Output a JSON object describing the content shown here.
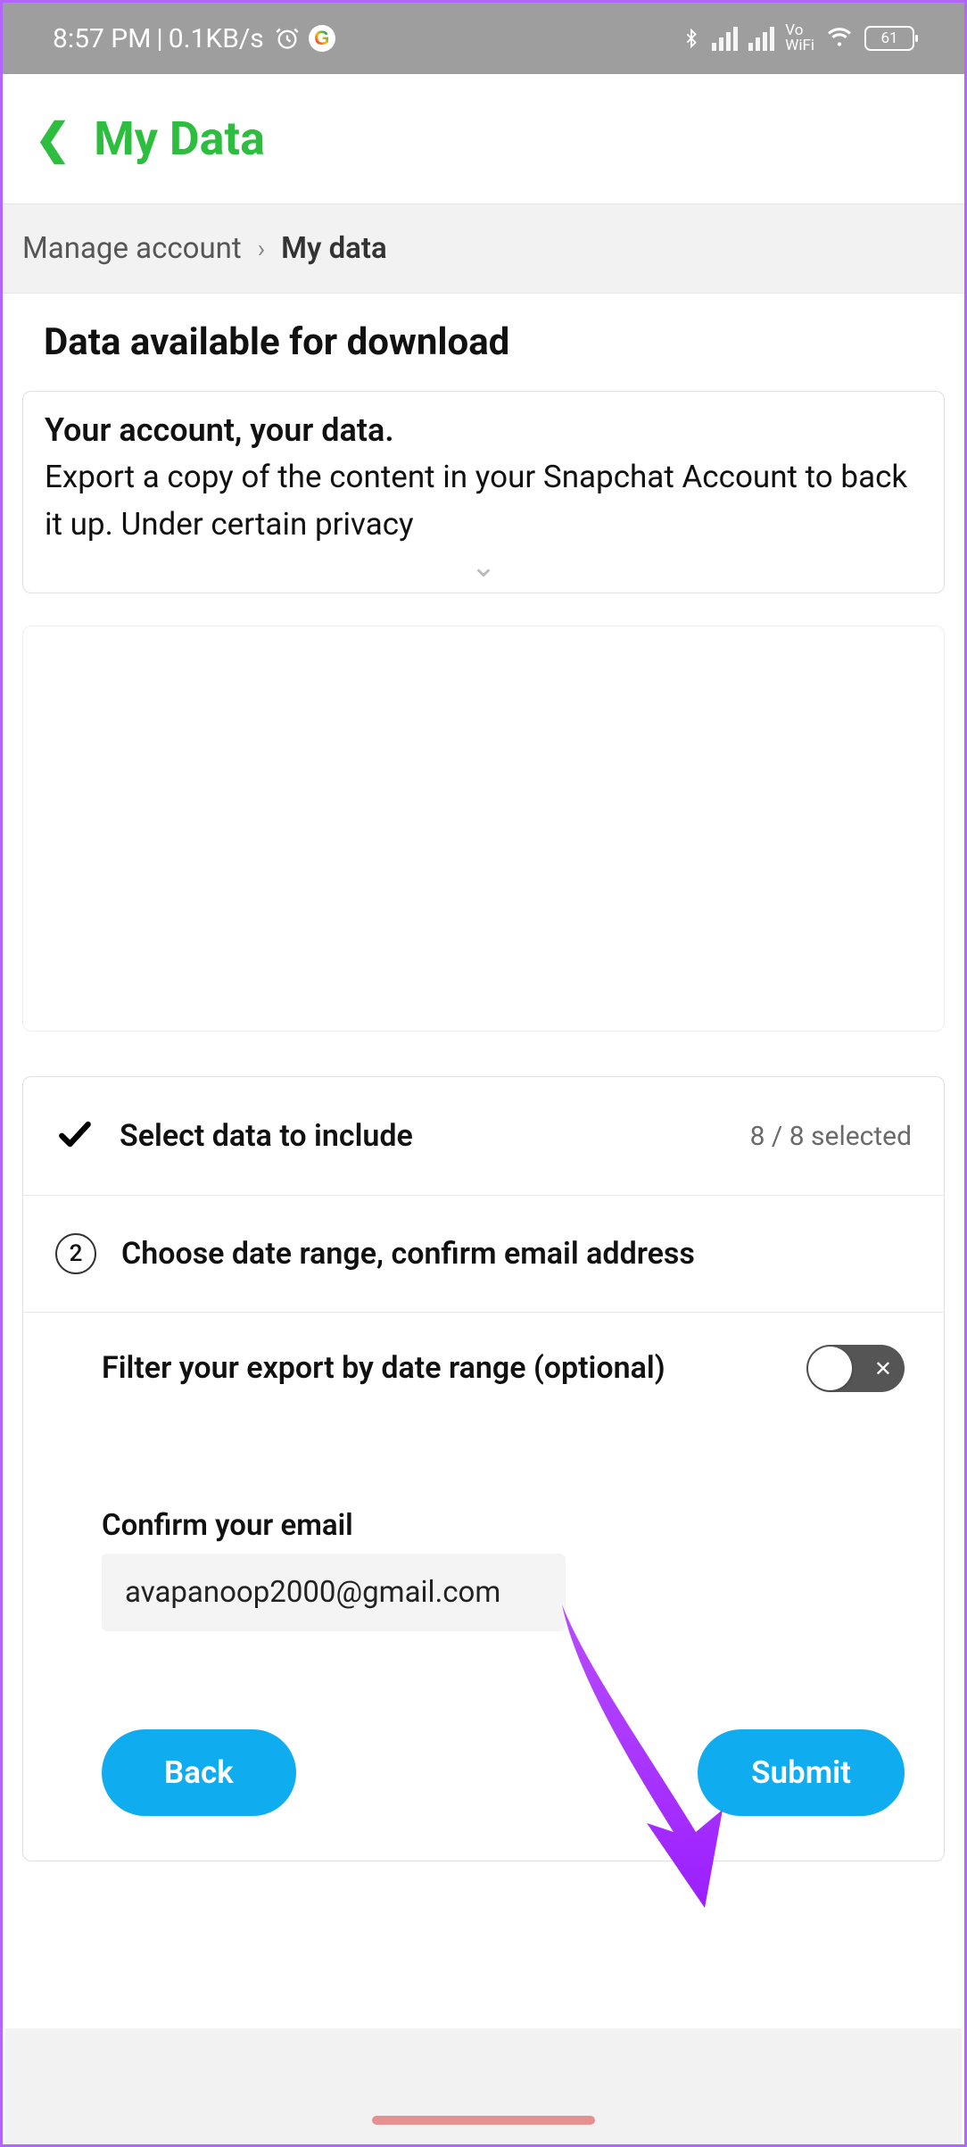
{
  "status": {
    "time": "8:57 PM",
    "net_speed": "0.1KB/s",
    "vowifi_top": "Vo",
    "vowifi_bottom": "WiFi",
    "battery": "61"
  },
  "nav": {
    "title": "My Data"
  },
  "breadcrumb": {
    "parent": "Manage account",
    "current": "My data"
  },
  "page": {
    "heading": "Data available for download"
  },
  "info": {
    "title": "Your account, your data.",
    "body": "Export a copy of the content in your Snapchat Account to back it up. Under certain privacy"
  },
  "steps": {
    "step1": {
      "label": "Select data to include",
      "meta": "8 / 8 selected"
    },
    "step2": {
      "num": "2",
      "label": "Choose date range, confirm email address",
      "filter_label": "Filter your export by date range (optional)",
      "confirm_label": "Confirm your email",
      "email_value": "avapanoop2000@gmail.com"
    }
  },
  "buttons": {
    "back": "Back",
    "submit": "Submit"
  }
}
